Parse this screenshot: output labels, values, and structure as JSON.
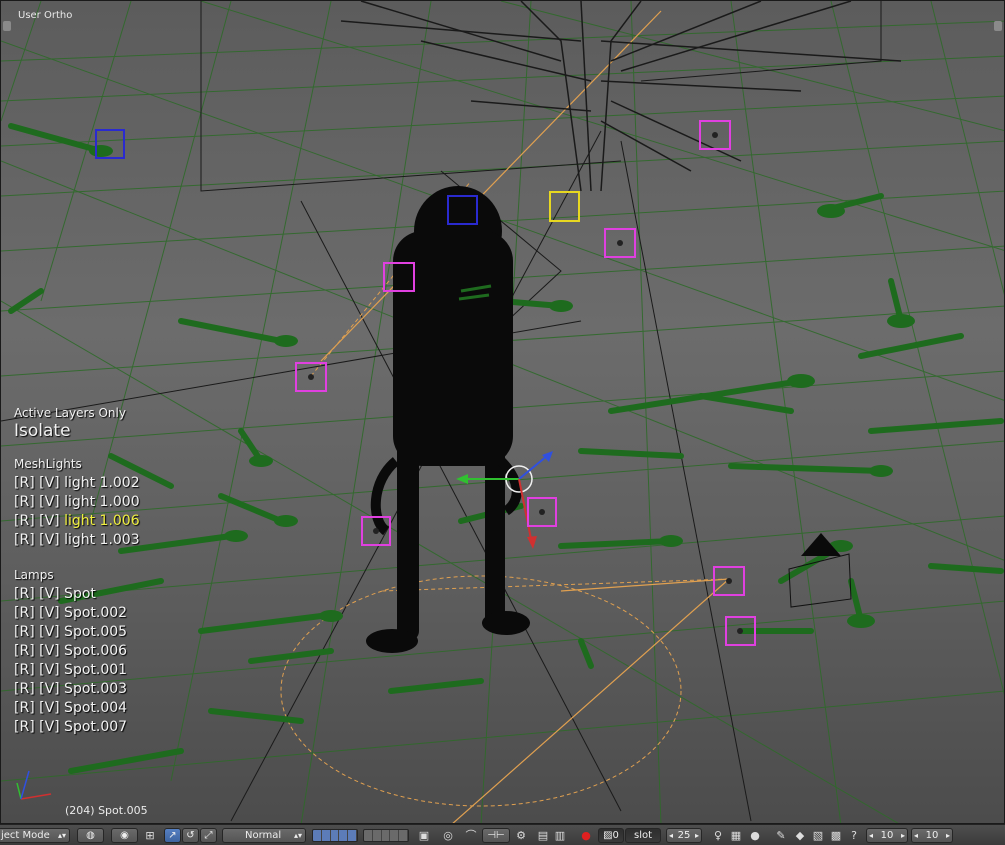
{
  "viewport": {
    "view_label": "User Ortho",
    "frame_info": "(204) Spot.005"
  },
  "overlay": {
    "active_layers": "Active Layers Only",
    "isolate": "Isolate",
    "meshlights_heading": "MeshLights",
    "meshlights": [
      {
        "prefix": "[R] [V] ",
        "name": "light 1.002",
        "selected": false
      },
      {
        "prefix": "[R] [V] ",
        "name": "light 1.000",
        "selected": false
      },
      {
        "prefix": "[R] [V] ",
        "name": "light 1.006",
        "selected": true
      },
      {
        "prefix": "[R] [V] ",
        "name": "light 1.003",
        "selected": false
      }
    ],
    "lamps_heading": "Lamps",
    "lamps": [
      "[R] [V] Spot",
      "[R] [V] Spot.002",
      "[R] [V] Spot.005",
      "[R] [V] Spot.006",
      "[R] [V] Spot.001",
      "[R] [V] Spot.003",
      "[R] [V] Spot.004",
      "[R] [V] Spot.007"
    ],
    "selected_color": "#f0f040"
  },
  "header": {
    "mode": "ject Mode",
    "pivot_icon": "globe-icon",
    "blend_mode": "Normal",
    "record_icon": "record-icon",
    "keying_count": "0",
    "keying_set": "slot",
    "frame": "25",
    "grid_x": "10",
    "grid_y": "10"
  },
  "scene_colors": {
    "grid": "#2a6a2a",
    "leaf": "#1e6b1e",
    "lamp_box": "#e040e0",
    "active_box": "#2a2ad0",
    "selected_box": "#e8d820",
    "cone": "#e0a050",
    "axis_x": "#d03030",
    "axis_y": "#30c030",
    "axis_z": "#3050e0"
  }
}
